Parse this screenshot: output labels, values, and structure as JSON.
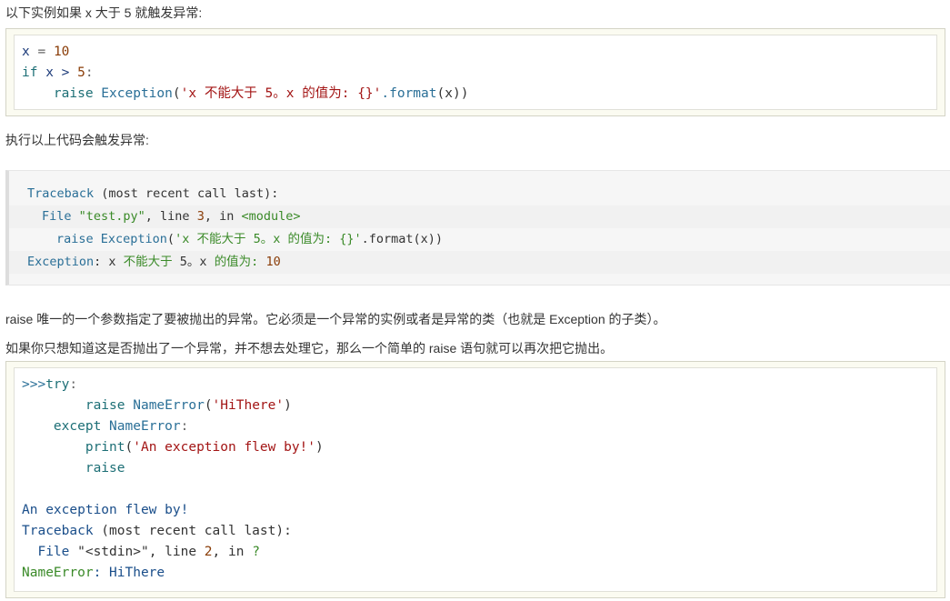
{
  "intro_text": "以下实例如果 x 大于 5 就触发异常:",
  "code1": {
    "line1": {
      "var": "x",
      "op": " = ",
      "num": "10"
    },
    "line2": {
      "kw": "if",
      "rest": " x > ",
      "num": "5",
      "colon": ":"
    },
    "line3": {
      "indent": "    ",
      "kw": "raise",
      "name": " Exception",
      "open": "(",
      "str": "'x 不能大于 5。x 的值为: {}'",
      "fmt": ".format",
      "args": "(x))"
    }
  },
  "exec_text": "执行以上代码会触发异常:",
  "traceback": {
    "line1": {
      "a": "Traceback",
      "b": " (most recent call last):"
    },
    "line2": {
      "a": "File ",
      "b": "\"test.py\"",
      "c": ", line ",
      "d": "3",
      "e": ", in ",
      "f": "<module>"
    },
    "line3": {
      "a": "raise",
      "b": " Exception",
      "c": "(",
      "d": "'x 不能大于 5。x 的值为: {}'",
      "e": ".format(x))"
    },
    "line4": {
      "a": "Exception",
      "b": ": x ",
      "c": "不能大于",
      "d": " 5。x ",
      "e": "的值为:",
      "f": " 10"
    }
  },
  "desc1": "raise 唯一的一个参数指定了要被抛出的异常。它必须是一个异常的实例或者是异常的类（也就是 Exception 的子类）。",
  "desc2": "如果你只想知道这是否抛出了一个异常，并不想去处理它，那么一个简单的 raise 语句就可以再次把它抛出。",
  "code2": {
    "l1a": ">>>",
    "l1b": "try",
    "l1c": ":",
    "l2a": "raise",
    "l2b": " NameError",
    "l2c": "(",
    "l2d": "'HiThere'",
    "l2e": ")",
    "l3a": "except",
    "l3b": " NameError",
    "l3c": ":",
    "l4a": "print",
    "l4b": "(",
    "l4c": "'An exception flew by!'",
    "l4d": ")",
    "l5a": "raise",
    "l7": "An exception flew by!",
    "l8a": "Traceback",
    "l8b": " (most recent call last):",
    "l9a": "  File ",
    "l9b": "\"<stdin>\"",
    "l9c": ", line ",
    "l9d": "2",
    "l9e": ", in ",
    "l9f": "?",
    "l10a": "NameError",
    "l10b": ": HiThere"
  }
}
